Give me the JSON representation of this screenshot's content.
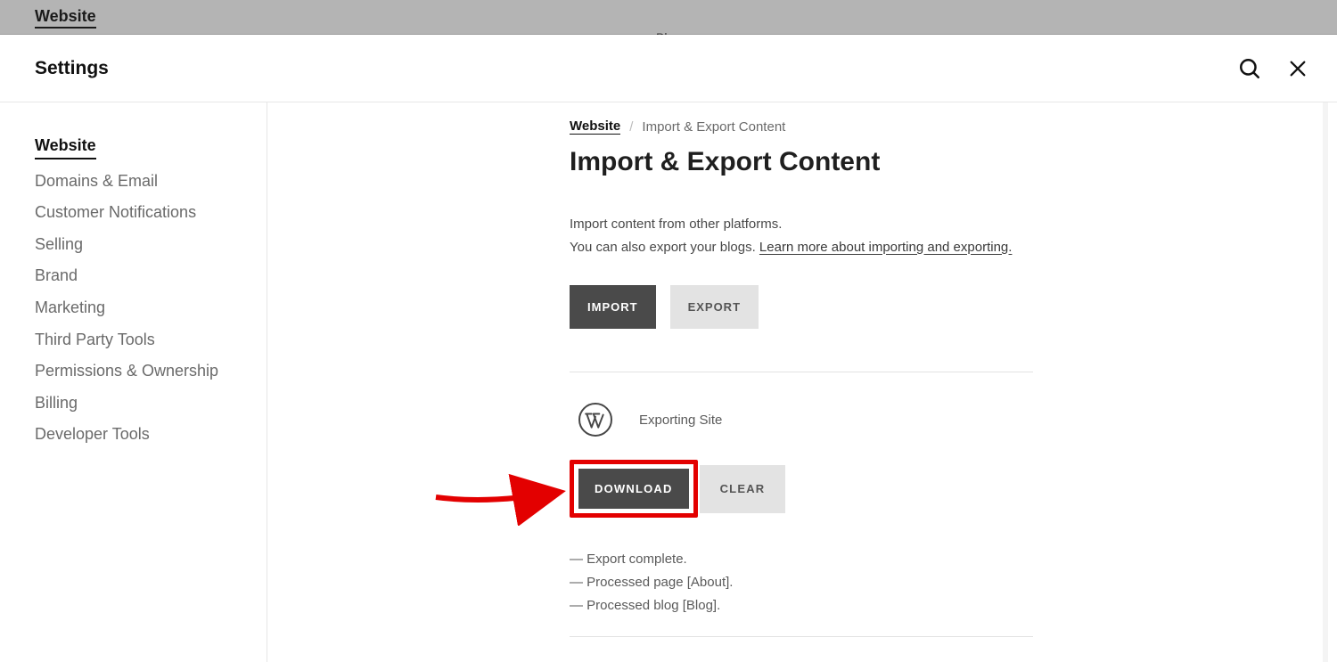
{
  "backdrop": {
    "title": "Website",
    "center_hint": "Blog"
  },
  "panel": {
    "title": "Settings"
  },
  "sidebar": {
    "items": [
      {
        "label": "Website",
        "active": true
      },
      {
        "label": "Domains & Email"
      },
      {
        "label": "Customer Notifications"
      },
      {
        "label": "Selling"
      },
      {
        "label": "Brand"
      },
      {
        "label": "Marketing"
      },
      {
        "label": "Third Party Tools"
      },
      {
        "label": "Permissions & Ownership"
      },
      {
        "label": "Billing"
      },
      {
        "label": "Developer Tools"
      }
    ]
  },
  "breadcrumb": {
    "root": "Website",
    "current": "Import & Export Content"
  },
  "page": {
    "title": "Import & Export Content",
    "intro_line1": "Import content from other platforms.",
    "intro_line2_prefix": "You can also export your blogs. ",
    "intro_link": "Learn more about importing and exporting."
  },
  "tabs": {
    "import": "IMPORT",
    "export": "EXPORT"
  },
  "export_block": {
    "status": "Exporting Site",
    "download": "DOWNLOAD",
    "clear": "CLEAR"
  },
  "log": [
    "— Export complete.",
    "— Processed page [About].",
    "— Processed blog [Blog]."
  ]
}
